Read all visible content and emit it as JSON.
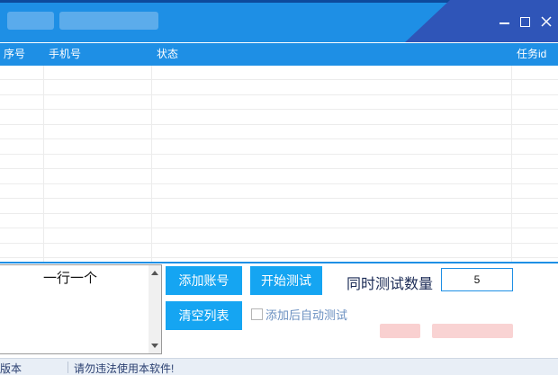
{
  "window": {
    "controls": {
      "minimize": "minimize-icon",
      "maximize": "maximize-icon",
      "close": "close-icon"
    }
  },
  "table": {
    "columns": [
      "序号",
      "手机号",
      "状态",
      "任务id"
    ],
    "rows": []
  },
  "input_area": {
    "text": "一行一个"
  },
  "buttons": {
    "add_account": "添加账号",
    "start_test": "开始测试",
    "clear_list": "清空列表"
  },
  "concurrency": {
    "label": "同时测试数量",
    "value": "5"
  },
  "auto_test": {
    "label": "添加后自动测试",
    "checked": false
  },
  "status_bar": {
    "left": "版本",
    "right": "请勿违法使用本软件!"
  },
  "colors": {
    "accent": "#1e8fe5",
    "button": "#15a5f2",
    "title_dark": "#2f55b8"
  }
}
